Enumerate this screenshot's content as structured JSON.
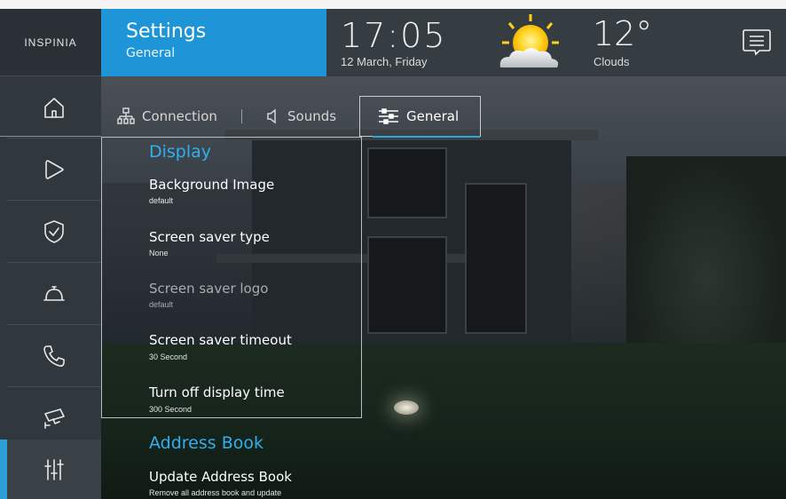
{
  "brand": {
    "logo_text": "INSPINIA"
  },
  "header": {
    "title": "Settings",
    "subtitle": "General",
    "time": "17:05",
    "date": "12 March, Friday",
    "temperature": "12°",
    "condition": "Clouds",
    "weather_icon": "sun-cloud-icon",
    "message_icon": "message-icon"
  },
  "sidebar": {
    "items": [
      {
        "name": "home",
        "icon": "home-icon"
      },
      {
        "name": "media",
        "icon": "play-icon"
      },
      {
        "name": "security",
        "icon": "shield-check-icon"
      },
      {
        "name": "services",
        "icon": "service-bell-icon"
      },
      {
        "name": "call",
        "icon": "phone-icon"
      },
      {
        "name": "camera",
        "icon": "camera-icon"
      },
      {
        "name": "settings",
        "icon": "sliders-icon",
        "active": true
      }
    ]
  },
  "tabs": [
    {
      "label": "Connection",
      "icon": "network-icon"
    },
    {
      "label": "Sounds",
      "icon": "speaker-icon"
    },
    {
      "label": "General",
      "icon": "sliders-icon",
      "active": true
    }
  ],
  "sections": {
    "display": {
      "title": "Display",
      "items": [
        {
          "title": "Background Image",
          "value": "default"
        },
        {
          "title": "Screen saver type",
          "value": "None"
        },
        {
          "title": "Screen saver logo",
          "value": "default",
          "disabled": true
        },
        {
          "title": "Screen saver timeout",
          "value": "30 Second"
        },
        {
          "title": "Turn off display time",
          "value": "300 Second"
        }
      ]
    },
    "address_book": {
      "title": "Address Book",
      "items": [
        {
          "title": "Update Address Book",
          "value": "Remove all address book and update"
        }
      ]
    }
  },
  "colors": {
    "accent": "#1e95d6",
    "section_title": "#2eb0f0",
    "sidebar_bg": "#30373d",
    "header_bg": "#353c42"
  }
}
